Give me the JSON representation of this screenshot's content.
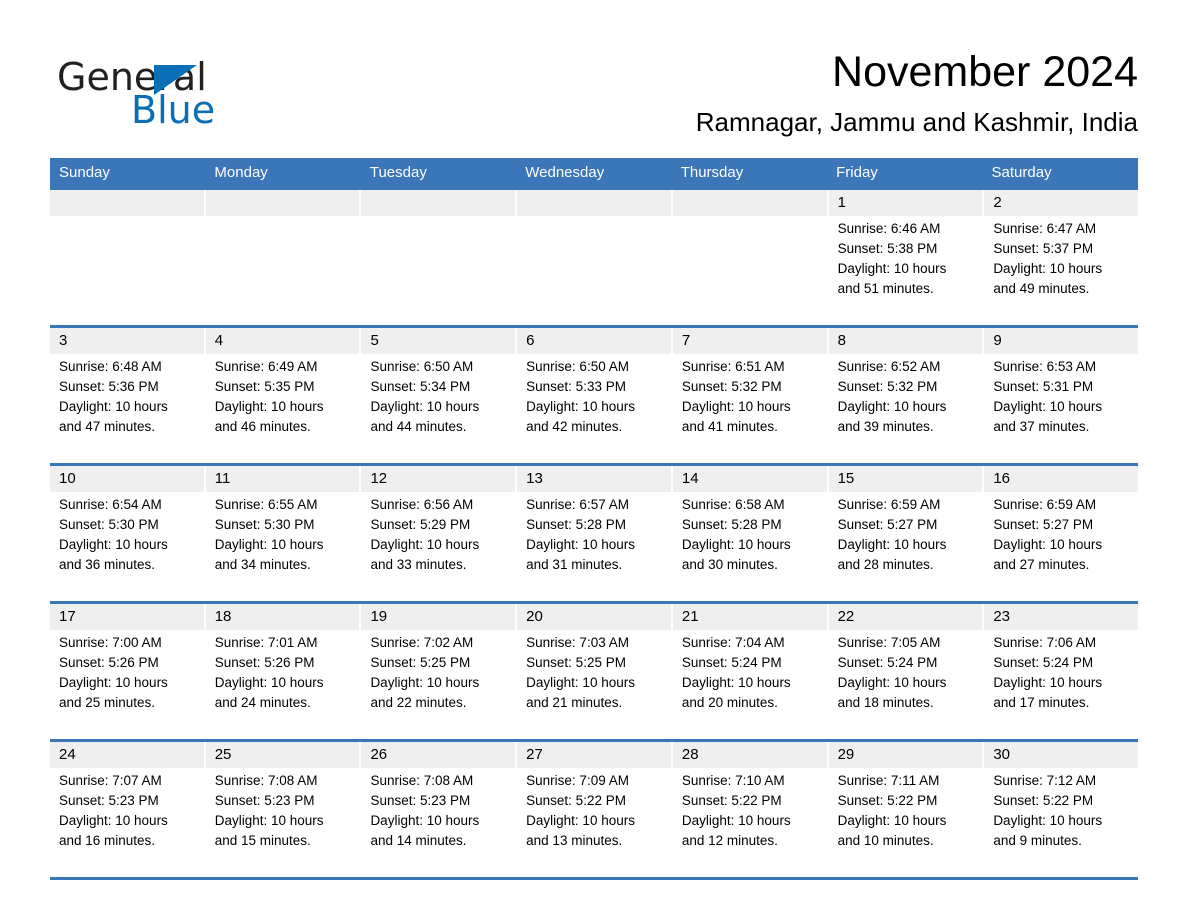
{
  "logo": {
    "word_one": "General",
    "word_two": "Blue",
    "triangle_icon": "triangle-icon",
    "accent_color": "#0b6fb8"
  },
  "header": {
    "title": "November 2024",
    "subtitle": "Ramnagar, Jammu and Kashmir, India"
  },
  "theme": {
    "header_blue": "#3a76b8",
    "day_band_grey": "#efefef",
    "text_black": "#000000"
  },
  "calendar": {
    "weekdays": [
      "Sunday",
      "Monday",
      "Tuesday",
      "Wednesday",
      "Thursday",
      "Friday",
      "Saturday"
    ],
    "weeks": [
      [
        {
          "day": "",
          "empty": true,
          "sunrise": "",
          "sunset": "",
          "daylight_line1": "",
          "daylight_line2": ""
        },
        {
          "day": "",
          "empty": true,
          "sunrise": "",
          "sunset": "",
          "daylight_line1": "",
          "daylight_line2": ""
        },
        {
          "day": "",
          "empty": true,
          "sunrise": "",
          "sunset": "",
          "daylight_line1": "",
          "daylight_line2": ""
        },
        {
          "day": "",
          "empty": true,
          "sunrise": "",
          "sunset": "",
          "daylight_line1": "",
          "daylight_line2": ""
        },
        {
          "day": "",
          "empty": true,
          "sunrise": "",
          "sunset": "",
          "daylight_line1": "",
          "daylight_line2": ""
        },
        {
          "day": "1",
          "empty": false,
          "sunrise": "Sunrise: 6:46 AM",
          "sunset": "Sunset: 5:38 PM",
          "daylight_line1": "Daylight: 10 hours",
          "daylight_line2": "and 51 minutes."
        },
        {
          "day": "2",
          "empty": false,
          "sunrise": "Sunrise: 6:47 AM",
          "sunset": "Sunset: 5:37 PM",
          "daylight_line1": "Daylight: 10 hours",
          "daylight_line2": "and 49 minutes."
        }
      ],
      [
        {
          "day": "3",
          "empty": false,
          "sunrise": "Sunrise: 6:48 AM",
          "sunset": "Sunset: 5:36 PM",
          "daylight_line1": "Daylight: 10 hours",
          "daylight_line2": "and 47 minutes."
        },
        {
          "day": "4",
          "empty": false,
          "sunrise": "Sunrise: 6:49 AM",
          "sunset": "Sunset: 5:35 PM",
          "daylight_line1": "Daylight: 10 hours",
          "daylight_line2": "and 46 minutes."
        },
        {
          "day": "5",
          "empty": false,
          "sunrise": "Sunrise: 6:50 AM",
          "sunset": "Sunset: 5:34 PM",
          "daylight_line1": "Daylight: 10 hours",
          "daylight_line2": "and 44 minutes."
        },
        {
          "day": "6",
          "empty": false,
          "sunrise": "Sunrise: 6:50 AM",
          "sunset": "Sunset: 5:33 PM",
          "daylight_line1": "Daylight: 10 hours",
          "daylight_line2": "and 42 minutes."
        },
        {
          "day": "7",
          "empty": false,
          "sunrise": "Sunrise: 6:51 AM",
          "sunset": "Sunset: 5:32 PM",
          "daylight_line1": "Daylight: 10 hours",
          "daylight_line2": "and 41 minutes."
        },
        {
          "day": "8",
          "empty": false,
          "sunrise": "Sunrise: 6:52 AM",
          "sunset": "Sunset: 5:32 PM",
          "daylight_line1": "Daylight: 10 hours",
          "daylight_line2": "and 39 minutes."
        },
        {
          "day": "9",
          "empty": false,
          "sunrise": "Sunrise: 6:53 AM",
          "sunset": "Sunset: 5:31 PM",
          "daylight_line1": "Daylight: 10 hours",
          "daylight_line2": "and 37 minutes."
        }
      ],
      [
        {
          "day": "10",
          "empty": false,
          "sunrise": "Sunrise: 6:54 AM",
          "sunset": "Sunset: 5:30 PM",
          "daylight_line1": "Daylight: 10 hours",
          "daylight_line2": "and 36 minutes."
        },
        {
          "day": "11",
          "empty": false,
          "sunrise": "Sunrise: 6:55 AM",
          "sunset": "Sunset: 5:30 PM",
          "daylight_line1": "Daylight: 10 hours",
          "daylight_line2": "and 34 minutes."
        },
        {
          "day": "12",
          "empty": false,
          "sunrise": "Sunrise: 6:56 AM",
          "sunset": "Sunset: 5:29 PM",
          "daylight_line1": "Daylight: 10 hours",
          "daylight_line2": "and 33 minutes."
        },
        {
          "day": "13",
          "empty": false,
          "sunrise": "Sunrise: 6:57 AM",
          "sunset": "Sunset: 5:28 PM",
          "daylight_line1": "Daylight: 10 hours",
          "daylight_line2": "and 31 minutes."
        },
        {
          "day": "14",
          "empty": false,
          "sunrise": "Sunrise: 6:58 AM",
          "sunset": "Sunset: 5:28 PM",
          "daylight_line1": "Daylight: 10 hours",
          "daylight_line2": "and 30 minutes."
        },
        {
          "day": "15",
          "empty": false,
          "sunrise": "Sunrise: 6:59 AM",
          "sunset": "Sunset: 5:27 PM",
          "daylight_line1": "Daylight: 10 hours",
          "daylight_line2": "and 28 minutes."
        },
        {
          "day": "16",
          "empty": false,
          "sunrise": "Sunrise: 6:59 AM",
          "sunset": "Sunset: 5:27 PM",
          "daylight_line1": "Daylight: 10 hours",
          "daylight_line2": "and 27 minutes."
        }
      ],
      [
        {
          "day": "17",
          "empty": false,
          "sunrise": "Sunrise: 7:00 AM",
          "sunset": "Sunset: 5:26 PM",
          "daylight_line1": "Daylight: 10 hours",
          "daylight_line2": "and 25 minutes."
        },
        {
          "day": "18",
          "empty": false,
          "sunrise": "Sunrise: 7:01 AM",
          "sunset": "Sunset: 5:26 PM",
          "daylight_line1": "Daylight: 10 hours",
          "daylight_line2": "and 24 minutes."
        },
        {
          "day": "19",
          "empty": false,
          "sunrise": "Sunrise: 7:02 AM",
          "sunset": "Sunset: 5:25 PM",
          "daylight_line1": "Daylight: 10 hours",
          "daylight_line2": "and 22 minutes."
        },
        {
          "day": "20",
          "empty": false,
          "sunrise": "Sunrise: 7:03 AM",
          "sunset": "Sunset: 5:25 PM",
          "daylight_line1": "Daylight: 10 hours",
          "daylight_line2": "and 21 minutes."
        },
        {
          "day": "21",
          "empty": false,
          "sunrise": "Sunrise: 7:04 AM",
          "sunset": "Sunset: 5:24 PM",
          "daylight_line1": "Daylight: 10 hours",
          "daylight_line2": "and 20 minutes."
        },
        {
          "day": "22",
          "empty": false,
          "sunrise": "Sunrise: 7:05 AM",
          "sunset": "Sunset: 5:24 PM",
          "daylight_line1": "Daylight: 10 hours",
          "daylight_line2": "and 18 minutes."
        },
        {
          "day": "23",
          "empty": false,
          "sunrise": "Sunrise: 7:06 AM",
          "sunset": "Sunset: 5:24 PM",
          "daylight_line1": "Daylight: 10 hours",
          "daylight_line2": "and 17 minutes."
        }
      ],
      [
        {
          "day": "24",
          "empty": false,
          "sunrise": "Sunrise: 7:07 AM",
          "sunset": "Sunset: 5:23 PM",
          "daylight_line1": "Daylight: 10 hours",
          "daylight_line2": "and 16 minutes."
        },
        {
          "day": "25",
          "empty": false,
          "sunrise": "Sunrise: 7:08 AM",
          "sunset": "Sunset: 5:23 PM",
          "daylight_line1": "Daylight: 10 hours",
          "daylight_line2": "and 15 minutes."
        },
        {
          "day": "26",
          "empty": false,
          "sunrise": "Sunrise: 7:08 AM",
          "sunset": "Sunset: 5:23 PM",
          "daylight_line1": "Daylight: 10 hours",
          "daylight_line2": "and 14 minutes."
        },
        {
          "day": "27",
          "empty": false,
          "sunrise": "Sunrise: 7:09 AM",
          "sunset": "Sunset: 5:22 PM",
          "daylight_line1": "Daylight: 10 hours",
          "daylight_line2": "and 13 minutes."
        },
        {
          "day": "28",
          "empty": false,
          "sunrise": "Sunrise: 7:10 AM",
          "sunset": "Sunset: 5:22 PM",
          "daylight_line1": "Daylight: 10 hours",
          "daylight_line2": "and 12 minutes."
        },
        {
          "day": "29",
          "empty": false,
          "sunrise": "Sunrise: 7:11 AM",
          "sunset": "Sunset: 5:22 PM",
          "daylight_line1": "Daylight: 10 hours",
          "daylight_line2": "and 10 minutes."
        },
        {
          "day": "30",
          "empty": false,
          "sunrise": "Sunrise: 7:12 AM",
          "sunset": "Sunset: 5:22 PM",
          "daylight_line1": "Daylight: 10 hours",
          "daylight_line2": "and 9 minutes."
        }
      ]
    ]
  }
}
